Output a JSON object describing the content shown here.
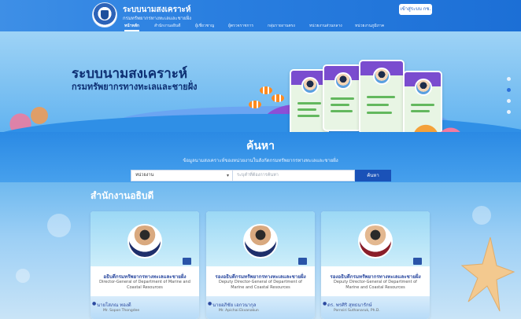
{
  "header": {
    "site_title": "ระบบนามสงเคราะห์",
    "site_subtitle": "กรมทรัพยากรทางทะเลและชายฝั่ง",
    "login_label": "เข้าสู่ระบบ กช."
  },
  "nav": {
    "items": [
      {
        "label": "หน้าหลัก",
        "active": true
      },
      {
        "label": "สำนักงานอธิบดี",
        "active": false
      },
      {
        "label": "ผู้เชี่ยวชาญ",
        "active": false
      },
      {
        "label": "ผู้ตรวจราชการ",
        "active": false
      },
      {
        "label": "กลุ่มรายงานตรง",
        "active": false
      },
      {
        "label": "หน่วยงานส่วนกลาง",
        "active": false
      },
      {
        "label": "หน่วยงานภูมิภาค",
        "active": false
      }
    ]
  },
  "hero": {
    "title": "ระบบนามสงเคราะห์",
    "subtitle": "กรมทรัพยากรทางทะเลและชายฝั่ง",
    "slides_total": 4,
    "slide_active": 2
  },
  "search": {
    "title": "ค้นหา",
    "description": "ข้อมูลนามสงเคราะห์ของหน่วยงานในสังกัดกรมทรัพยากรทางทะเลและชายฝั่ง",
    "select_value": "หน่วยงาน",
    "input_placeholder": "ระบุคำที่ต้องการค้นหา",
    "button_label": "ค้นหา"
  },
  "section": {
    "title": "สำนักงานอธิบดี"
  },
  "executives": [
    {
      "title_th": "อธิบดีกรมทรัพยากรทางทะเลและชายฝั่ง",
      "title_en": "Director-General of Department of Marine and Coastal Resources",
      "name_th": "นายโสภณ ทองดี",
      "name_en": "Mr. Sopon Thongdee"
    },
    {
      "title_th": "รองอธิบดีกรมทรัพยากรทางทะเลและชายฝั่ง",
      "title_en": "Deputy Director-General of Department of Marine and Coastal Resources",
      "name_th": "นายอภิชัย เอกวนากุล",
      "name_en": "Mr. Apichai Ekvanakun"
    },
    {
      "title_th": "รองอธิบดีกรมทรัพยากรทางทะเลและชายฝั่ง",
      "title_en": "Deputy Director-General of Department of Marine and Coastal Resources",
      "name_th": "ดร. พรศิริ สุทธนารักษ์",
      "name_en": "Pornsiri Suthanaruk, Ph.D."
    }
  ],
  "colors": {
    "header_blue": "#2a7fe0",
    "accent_navy": "#1a52b8",
    "title_navy": "#0d2f73",
    "card_title": "#2c4aa0"
  }
}
